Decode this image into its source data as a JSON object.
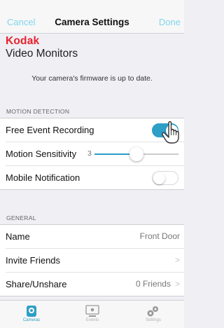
{
  "navbar": {
    "cancel_label": "Cancel",
    "title": "Camera Settings",
    "done_label": "Done"
  },
  "brand": {
    "logo_text": "Kodak",
    "product_name": "Video Monitors"
  },
  "firmware_message": "Your camera's firmware is up to date.",
  "motion_detection": {
    "header": "MOTION DETECTION",
    "free_event_recording": {
      "label": "Free Event Recording",
      "enabled": true
    },
    "motion_sensitivity": {
      "label": "Motion Sensitivity",
      "value": "3",
      "level_fraction": 0.5
    },
    "mobile_notification": {
      "label": "Mobile Notification",
      "enabled": false
    }
  },
  "general": {
    "header": "GENERAL",
    "name": {
      "label": "Name",
      "value": "Front Door"
    },
    "invite_friends": {
      "label": "Invite Friends"
    },
    "share_unshare": {
      "label": "Share/Unshare",
      "value": "0 Friends"
    }
  },
  "tabbar": {
    "tabs": [
      {
        "label": "Cameras",
        "icon": "camera-icon",
        "active": true
      },
      {
        "label": "Events",
        "icon": "events-icon",
        "active": false
      },
      {
        "label": "Settings",
        "icon": "settings-icon",
        "active": false
      }
    ]
  },
  "colors": {
    "accent": "#2e9fc7",
    "nav_link": "#7fd6ee",
    "brand_red": "#e8202c"
  }
}
